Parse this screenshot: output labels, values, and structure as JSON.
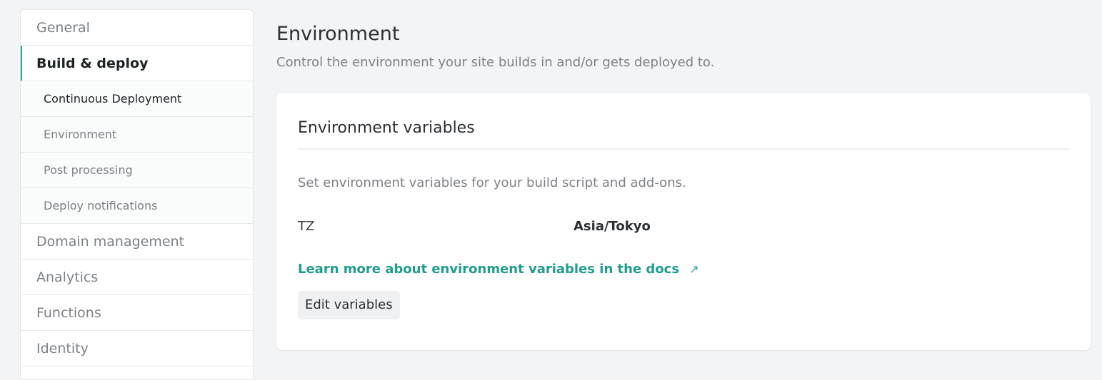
{
  "sidebar": {
    "items": [
      {
        "label": "General"
      },
      {
        "label": "Build & deploy"
      },
      {
        "label": "Continuous Deployment"
      },
      {
        "label": "Environment"
      },
      {
        "label": "Post processing"
      },
      {
        "label": "Deploy notifications"
      },
      {
        "label": "Domain management"
      },
      {
        "label": "Analytics"
      },
      {
        "label": "Functions"
      },
      {
        "label": "Identity"
      }
    ]
  },
  "page": {
    "title": "Environment",
    "subtitle": "Control the environment your site builds in and/or gets deployed to."
  },
  "card": {
    "title": "Environment variables",
    "description": "Set environment variables for your build script and add-ons.",
    "variables": [
      {
        "key": "TZ",
        "value": "Asia/Tokyo"
      }
    ],
    "docs_link": "Learn more about environment variables in the docs",
    "docs_link_icon": "external-link-icon",
    "edit_button": "Edit variables"
  },
  "colors": {
    "accent": "#2aa191",
    "background": "#f2f4f6"
  }
}
